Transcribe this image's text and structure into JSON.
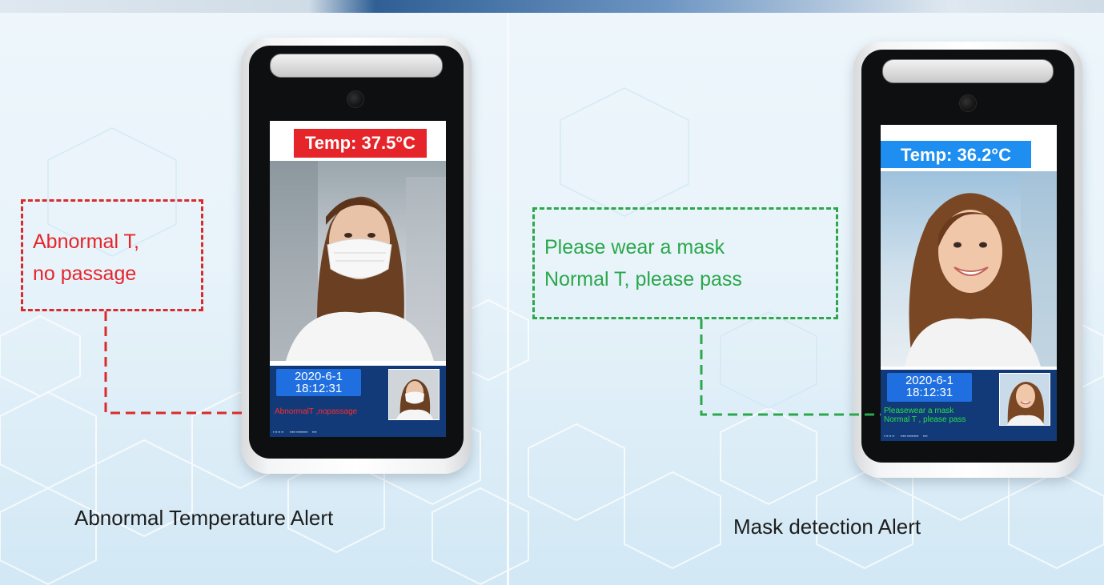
{
  "left_panel": {
    "screen_temp": "Temp: 37.5°C",
    "date": "2020-6-1",
    "time": "18:12:31",
    "status": "AbnormalT ,nopassage",
    "callout": [
      "Abnormal T,",
      "no passage"
    ],
    "caption": "Abnormal Temperature Alert"
  },
  "right_panel": {
    "screen_temp": "Temp: 36.2°C",
    "date": "2020-6-1",
    "time": "18:12:31",
    "status": [
      "Pleasewear a mask",
      "Normal T , please pass"
    ],
    "callout": [
      "Please wear a mask",
      "Normal T, please pass"
    ],
    "caption": "Mask detection Alert"
  },
  "colors": {
    "alert_red": "#e5252a",
    "ok_green": "#2aa84a",
    "ok_blue": "#1e8ff0",
    "screen_bar": "#133a78"
  }
}
